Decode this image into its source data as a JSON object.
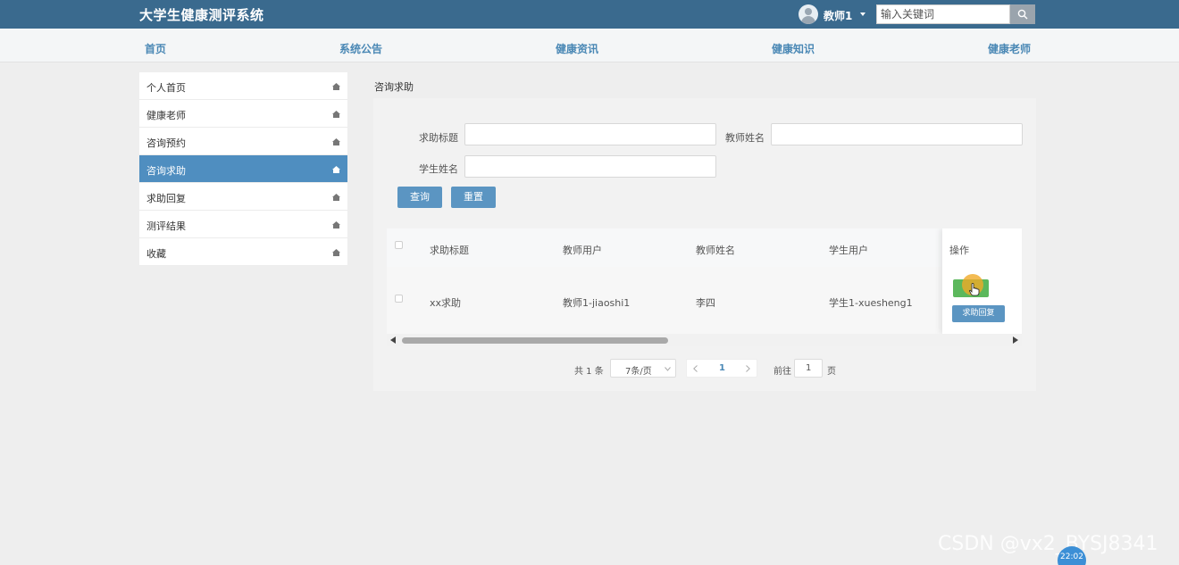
{
  "app": {
    "title": "大学生健康测评系统"
  },
  "user": {
    "name": "教师1"
  },
  "search": {
    "placeholder": "输入关键词"
  },
  "nav": [
    "首页",
    "系统公告",
    "健康资讯",
    "健康知识",
    "健康老师"
  ],
  "sidebar": {
    "items": [
      {
        "label": "个人首页",
        "active": false
      },
      {
        "label": "健康老师",
        "active": false
      },
      {
        "label": "咨询预约",
        "active": false
      },
      {
        "label": "咨询求助",
        "active": true
      },
      {
        "label": "求助回复",
        "active": false
      },
      {
        "label": "测评结果",
        "active": false
      },
      {
        "label": "收藏",
        "active": false
      }
    ]
  },
  "breadcrumb": "咨询求助",
  "filters": {
    "title_label": "求助标题",
    "teacher_name_label": "教师姓名",
    "student_name_label": "学生姓名",
    "query_button": "查询",
    "reset_button": "重置"
  },
  "table": {
    "columns": [
      "求助标题",
      "教师用户",
      "教师姓名",
      "学生用户",
      "操作"
    ],
    "rows": [
      {
        "title": "xx求助",
        "teacher_user": "教师1-jiaoshi1",
        "teacher_name": "李四",
        "student_user": "学生1-xuesheng1"
      }
    ],
    "reply_button": "求助回复"
  },
  "pagination": {
    "total": "共 1 条",
    "page_size": "7条/页",
    "current_page": "1",
    "goto_label": "前往",
    "goto_value": "1",
    "page_suffix": "页"
  },
  "watermark": "CSDN @vx2_BYSJ8341",
  "clock": "22:02",
  "colors": {
    "topbar": "#3a6a8e",
    "accent": "#4f8ec0",
    "button": "#5b95c2",
    "view_button": "#5cb85c"
  }
}
